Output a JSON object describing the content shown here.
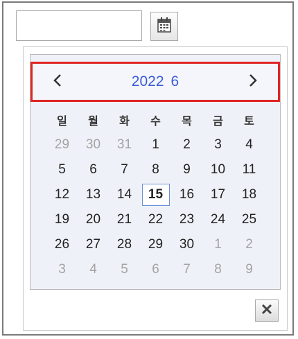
{
  "date_field": {
    "value": "",
    "placeholder": ""
  },
  "icons": {
    "calendar_button": "calendar-icon",
    "prev": "chevron-left-icon",
    "next": "chevron-right-icon",
    "close": "close-icon"
  },
  "calendar": {
    "year": "2022",
    "month": "6",
    "weekdays": [
      "일",
      "월",
      "화",
      "수",
      "목",
      "금",
      "토"
    ],
    "weeks": [
      [
        {
          "d": "29",
          "other": true
        },
        {
          "d": "30",
          "other": true
        },
        {
          "d": "31",
          "other": true
        },
        {
          "d": "1"
        },
        {
          "d": "2"
        },
        {
          "d": "3"
        },
        {
          "d": "4"
        }
      ],
      [
        {
          "d": "5"
        },
        {
          "d": "6"
        },
        {
          "d": "7"
        },
        {
          "d": "8"
        },
        {
          "d": "9"
        },
        {
          "d": "10"
        },
        {
          "d": "11"
        }
      ],
      [
        {
          "d": "12"
        },
        {
          "d": "13"
        },
        {
          "d": "14"
        },
        {
          "d": "15",
          "today": true
        },
        {
          "d": "16"
        },
        {
          "d": "17"
        },
        {
          "d": "18"
        }
      ],
      [
        {
          "d": "19"
        },
        {
          "d": "20"
        },
        {
          "d": "21"
        },
        {
          "d": "22"
        },
        {
          "d": "23"
        },
        {
          "d": "24"
        },
        {
          "d": "25"
        }
      ],
      [
        {
          "d": "26"
        },
        {
          "d": "27"
        },
        {
          "d": "28"
        },
        {
          "d": "29"
        },
        {
          "d": "30"
        },
        {
          "d": "1",
          "other": true
        },
        {
          "d": "2",
          "other": true
        }
      ],
      [
        {
          "d": "3",
          "other": true
        },
        {
          "d": "4",
          "other": true
        },
        {
          "d": "5",
          "other": true
        },
        {
          "d": "6",
          "other": true
        },
        {
          "d": "7",
          "other": true
        },
        {
          "d": "8",
          "other": true
        },
        {
          "d": "9",
          "other": true
        }
      ]
    ]
  },
  "colors": {
    "title": "#3a5bd9",
    "header_border": "#e02424",
    "panel_bg": "#eef1f7",
    "today_border": "#6b8fd6",
    "other_month": "#a3a3a3"
  }
}
